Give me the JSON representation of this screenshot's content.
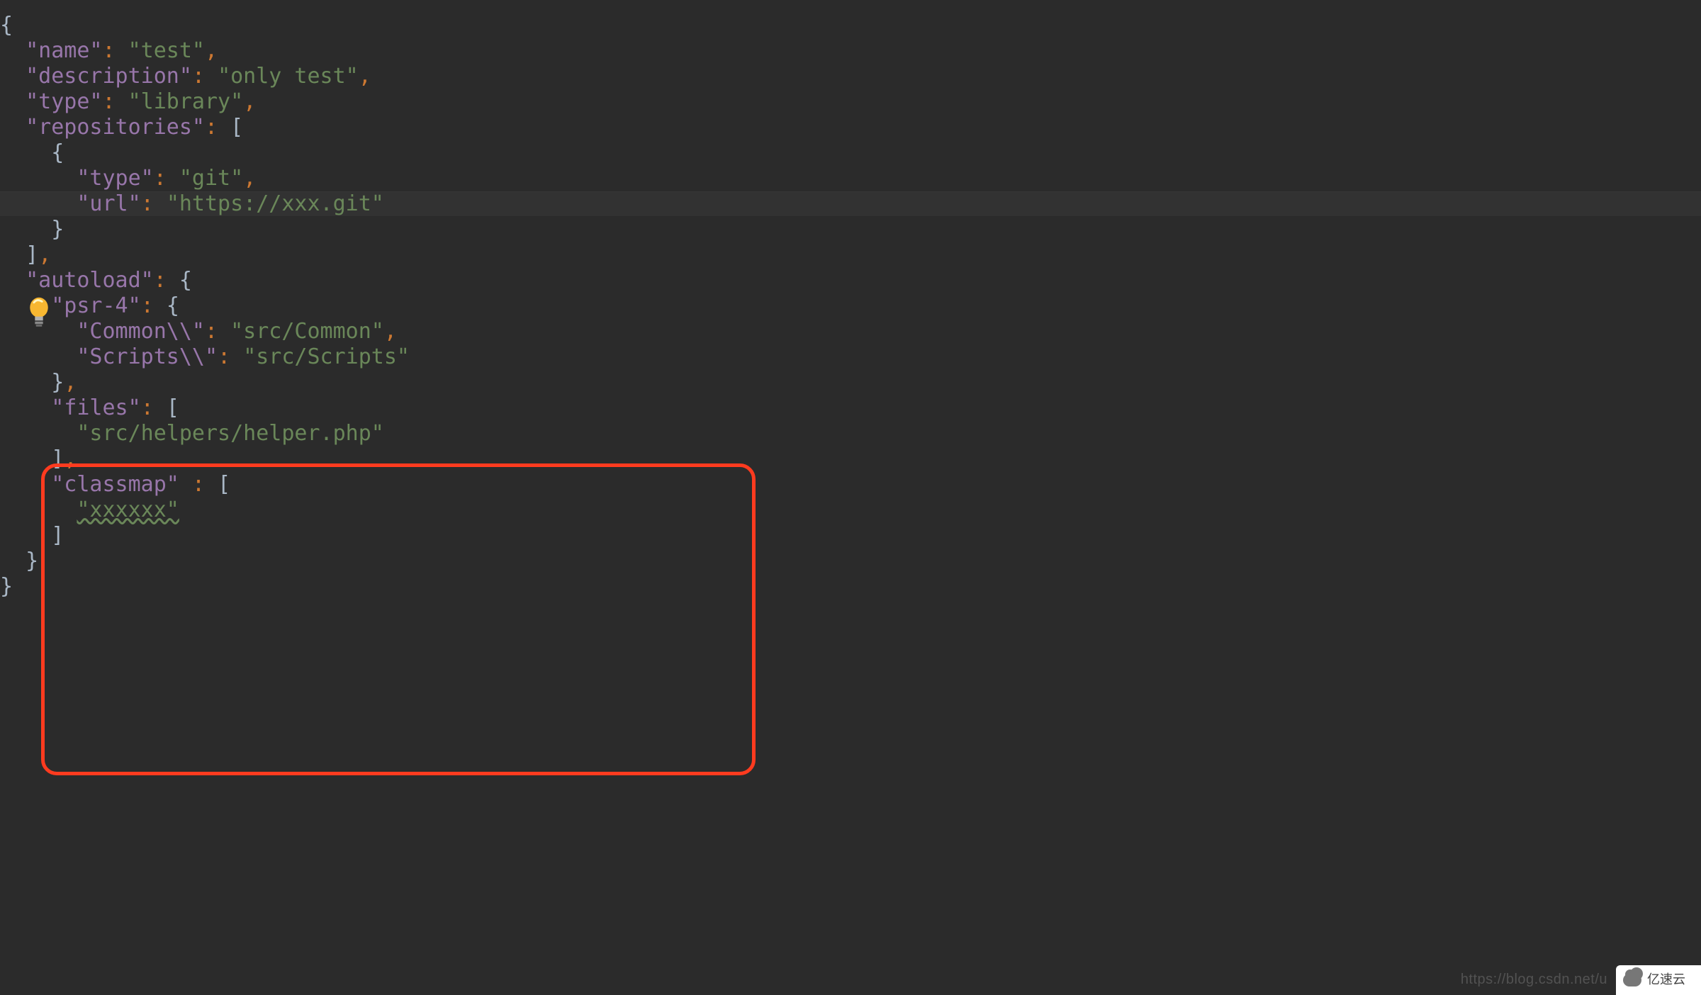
{
  "bulb_icon": "lightbulb",
  "code_tokens": [
    [
      {
        "t": "{",
        "c": "tok-brace"
      }
    ],
    [
      {
        "t": "  ",
        "c": ""
      },
      {
        "t": "\"name\"",
        "c": "tok-key"
      },
      {
        "t": ":",
        "c": "tok-colon"
      },
      {
        "t": " ",
        "c": ""
      },
      {
        "t": "\"test\"",
        "c": "tok-str"
      },
      {
        "t": ",",
        "c": "tok-comma"
      }
    ],
    [
      {
        "t": "  ",
        "c": ""
      },
      {
        "t": "\"description\"",
        "c": "tok-key"
      },
      {
        "t": ":",
        "c": "tok-colon"
      },
      {
        "t": " ",
        "c": ""
      },
      {
        "t": "\"only test\"",
        "c": "tok-str"
      },
      {
        "t": ",",
        "c": "tok-comma"
      }
    ],
    [
      {
        "t": "  ",
        "c": ""
      },
      {
        "t": "\"type\"",
        "c": "tok-key"
      },
      {
        "t": ":",
        "c": "tok-colon"
      },
      {
        "t": " ",
        "c": ""
      },
      {
        "t": "\"library\"",
        "c": "tok-str"
      },
      {
        "t": ",",
        "c": "tok-comma"
      }
    ],
    [
      {
        "t": "  ",
        "c": ""
      },
      {
        "t": "\"repositories\"",
        "c": "tok-key"
      },
      {
        "t": ":",
        "c": "tok-colon"
      },
      {
        "t": " ",
        "c": ""
      },
      {
        "t": "[",
        "c": "tok-bracket"
      }
    ],
    [
      {
        "t": "    ",
        "c": ""
      },
      {
        "t": "{",
        "c": "tok-brace"
      }
    ],
    [
      {
        "t": "      ",
        "c": ""
      },
      {
        "t": "\"type\"",
        "c": "tok-key"
      },
      {
        "t": ":",
        "c": "tok-colon"
      },
      {
        "t": " ",
        "c": ""
      },
      {
        "t": "\"git\"",
        "c": "tok-str"
      },
      {
        "t": ",",
        "c": "tok-comma"
      }
    ],
    [
      {
        "t": "      ",
        "c": ""
      },
      {
        "t": "\"url\"",
        "c": "tok-key"
      },
      {
        "t": ":",
        "c": "tok-colon"
      },
      {
        "t": " ",
        "c": ""
      },
      {
        "t": "\"https://xxx.git\"",
        "c": "tok-str"
      }
    ],
    [
      {
        "t": "    ",
        "c": ""
      },
      {
        "t": "}",
        "c": "tok-brace"
      }
    ],
    [
      {
        "t": "  ",
        "c": ""
      },
      {
        "t": "]",
        "c": "tok-bracket"
      },
      {
        "t": ",",
        "c": "tok-comma"
      }
    ],
    [
      {
        "t": "  ",
        "c": ""
      },
      {
        "t": "\"autoload\"",
        "c": "tok-key"
      },
      {
        "t": ":",
        "c": "tok-colon"
      },
      {
        "t": " ",
        "c": ""
      },
      {
        "t": "{",
        "c": "tok-brace"
      }
    ],
    [
      {
        "t": "    ",
        "c": ""
      },
      {
        "t": "\"psr-4\"",
        "c": "tok-key"
      },
      {
        "t": ":",
        "c": "tok-colon"
      },
      {
        "t": " ",
        "c": ""
      },
      {
        "t": "{",
        "c": "tok-brace"
      }
    ],
    [
      {
        "t": "      ",
        "c": ""
      },
      {
        "t": "\"Common\\\\\"",
        "c": "tok-key"
      },
      {
        "t": ":",
        "c": "tok-colon"
      },
      {
        "t": " ",
        "c": ""
      },
      {
        "t": "\"src/Common\"",
        "c": "tok-str"
      },
      {
        "t": ",",
        "c": "tok-comma"
      }
    ],
    [
      {
        "t": "      ",
        "c": ""
      },
      {
        "t": "\"Scripts\\\\\"",
        "c": "tok-key"
      },
      {
        "t": ":",
        "c": "tok-colon"
      },
      {
        "t": " ",
        "c": ""
      },
      {
        "t": "\"src/Scripts\"",
        "c": "tok-str"
      }
    ],
    [
      {
        "t": "    ",
        "c": ""
      },
      {
        "t": "}",
        "c": "tok-brace"
      },
      {
        "t": ",",
        "c": "tok-comma"
      }
    ],
    [
      {
        "t": "    ",
        "c": ""
      },
      {
        "t": "\"files\"",
        "c": "tok-key"
      },
      {
        "t": ":",
        "c": "tok-colon"
      },
      {
        "t": " ",
        "c": ""
      },
      {
        "t": "[",
        "c": "tok-bracket"
      }
    ],
    [
      {
        "t": "      ",
        "c": ""
      },
      {
        "t": "\"src/helpers/helper.php\"",
        "c": "tok-str"
      }
    ],
    [
      {
        "t": "    ",
        "c": ""
      },
      {
        "t": "]",
        "c": "tok-bracket"
      },
      {
        "t": ",",
        "c": "tok-comma"
      }
    ],
    [
      {
        "t": "    ",
        "c": ""
      },
      {
        "t": "\"classmap\"",
        "c": "tok-key"
      },
      {
        "t": " ",
        "c": ""
      },
      {
        "t": ":",
        "c": "tok-colon"
      },
      {
        "t": " ",
        "c": ""
      },
      {
        "t": "[",
        "c": "tok-bracket"
      }
    ],
    [
      {
        "t": "      ",
        "c": ""
      },
      {
        "t": "\"xxxxxx\"",
        "c": "tok-str-classmap"
      }
    ],
    [
      {
        "t": "    ",
        "c": ""
      },
      {
        "t": "]",
        "c": "tok-bracket"
      }
    ],
    [
      {
        "t": "  ",
        "c": ""
      },
      {
        "t": "}",
        "c": "tok-brace"
      }
    ],
    [
      {
        "t": "}",
        "c": "tok-brace"
      }
    ]
  ],
  "highlight_line_index": 7,
  "watermark_blog": "https://blog.csdn.net/u",
  "watermark_badge_text": "亿速云"
}
